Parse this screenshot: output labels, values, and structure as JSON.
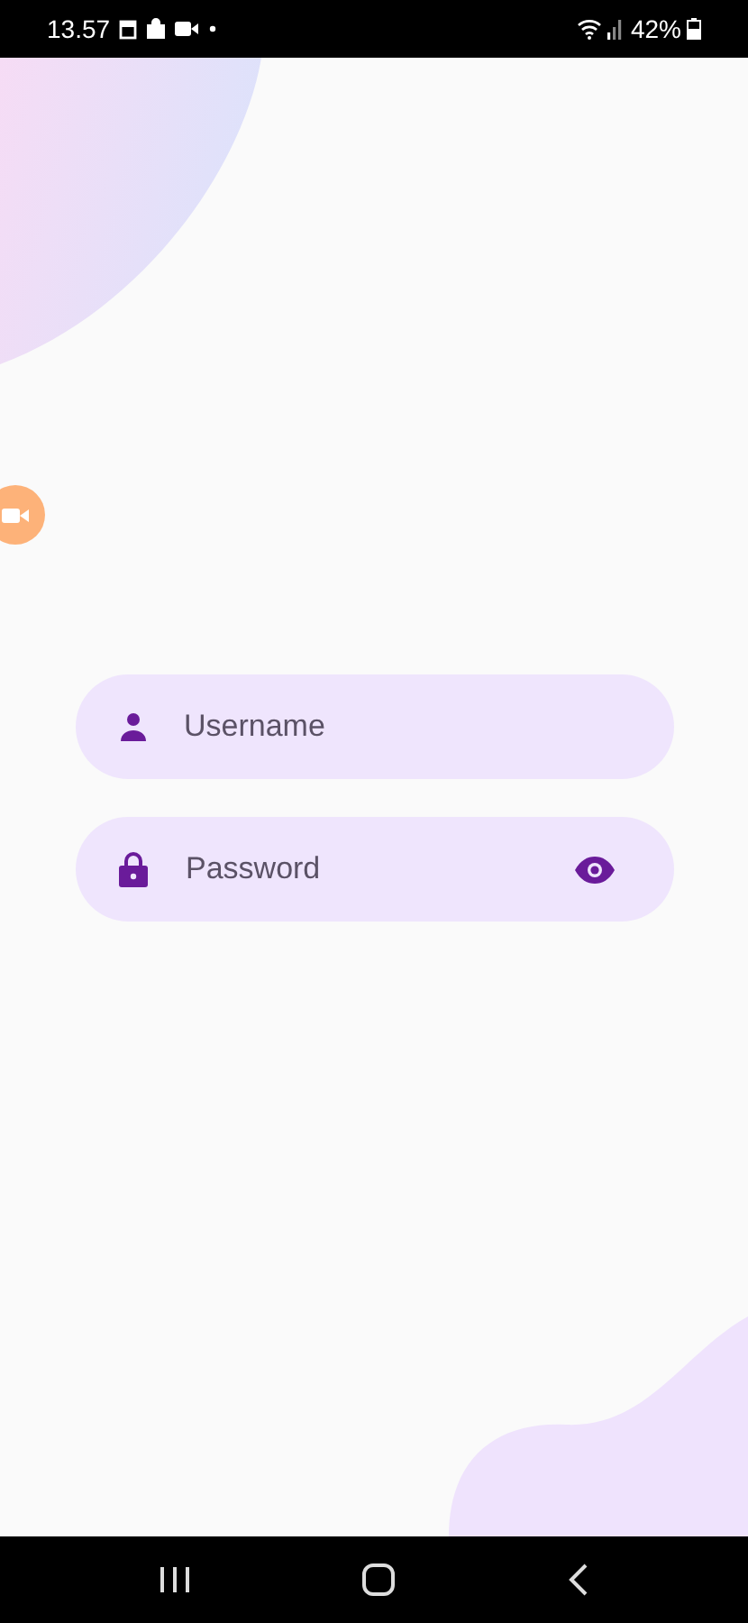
{
  "status_bar": {
    "time": "13.57",
    "battery": "42%"
  },
  "login_form": {
    "username": {
      "placeholder": "Username"
    },
    "password": {
      "placeholder": "Password"
    }
  }
}
